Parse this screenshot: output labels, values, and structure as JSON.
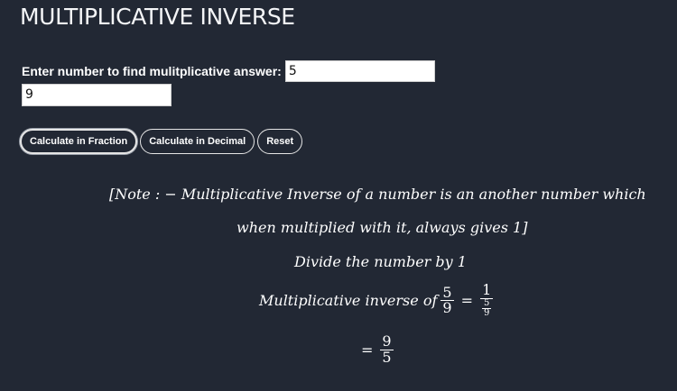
{
  "page": {
    "title": "MULTIPLICATIVE INVERSE"
  },
  "form": {
    "prompt_label": "Enter number to find mulitplicative answer:",
    "numerator_value": "5",
    "denominator_value": "9"
  },
  "buttons": {
    "fraction": "Calculate in Fraction",
    "decimal": "Calculate in Decimal",
    "reset": "Reset"
  },
  "output": {
    "note_line1": "[Note : − Multiplicative Inverse of a number is an another number which",
    "note_line2": "when multiplied with it, always gives 1]",
    "divide_text": "Divide the number by 1",
    "inverse_label": "Multiplicative inverse of",
    "equals": "=",
    "fraction_num": "5",
    "fraction_den": "9",
    "one": "1",
    "inner_num": "5",
    "inner_den": "9",
    "result_num": "9",
    "result_den": "5"
  }
}
